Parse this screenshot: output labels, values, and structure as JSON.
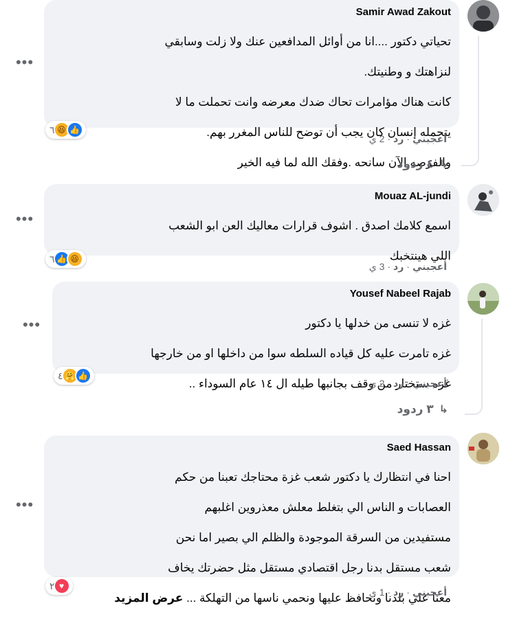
{
  "comments": [
    {
      "author": "Samir Awad Zakout",
      "lines": [
        "تحياتي دكتور ....انا من أوائل المدافعين عنك ولا زلت وسابقي",
        "لنزاهتك و وطنيتك.",
        "كانت هناك مؤامرات تحاك ضدك معرضه وانت تحملت ما لا",
        "يتحمله إنسان كان يجب أن توضح للناس المغرر بهم.",
        "والفرصه الآن سانحه .وفقك الله لما فيه الخير"
      ],
      "reaction_count": "٦",
      "reactions": [
        "like-icon",
        "haha-icon"
      ],
      "like_label": "أعجبني",
      "reply_label": "رد",
      "time": "2 ي",
      "replies_label": "٤ ردود"
    },
    {
      "author": "Mouaz AL-jundi",
      "lines": [
        "اسمع كلامك اصدق . اشوف قرارات معاليك العن ابو الشعب",
        "اللي هينتخبك"
      ],
      "reaction_count": "٦",
      "reactions": [
        "haha-icon",
        "like-icon"
      ],
      "like_label": "أعجبني",
      "reply_label": "رد",
      "time": "3 ي"
    },
    {
      "author": "Yousef Nabeel Rajab",
      "lines": [
        "غزه لا تنسى من خدلها يا دكتور",
        "غزه تامرت عليه كل قياده السلطه سوا من داخلها او من خارجها",
        "غزه ستختار من وقف بجانبها طيله ال ١٤ عام السوداء .."
      ],
      "reaction_count": "٤",
      "reactions": [
        "like-icon",
        "care-icon"
      ],
      "like_label": "أعجبني",
      "reply_label": "رد",
      "time": "2 ي",
      "replies_label": "٣ ردود"
    },
    {
      "author": "Saed Hassan",
      "lines": [
        "احنا في انتظارك يا دكتور شعب غزة محتاجك تعبنا من حكم",
        "العصابات و الناس الي بتغلط معلش معذروين اغلبهم",
        "مستفيدين من السرقة الموجودة والظلم الي بصير اما نحن",
        "شعب مستقل بدنا رجل اقتصادي مستقل مثل حضرتك يخاف",
        "معنا علي بلدنا ونحافظ عليها ونحمي ناسها من التهلكة ..."
      ],
      "see_more": "عرض المزيد",
      "reaction_count": "٢",
      "reactions": [
        "love-icon"
      ],
      "like_label": "أعجبني",
      "reply_label": "رد",
      "time": "1 ي"
    }
  ]
}
